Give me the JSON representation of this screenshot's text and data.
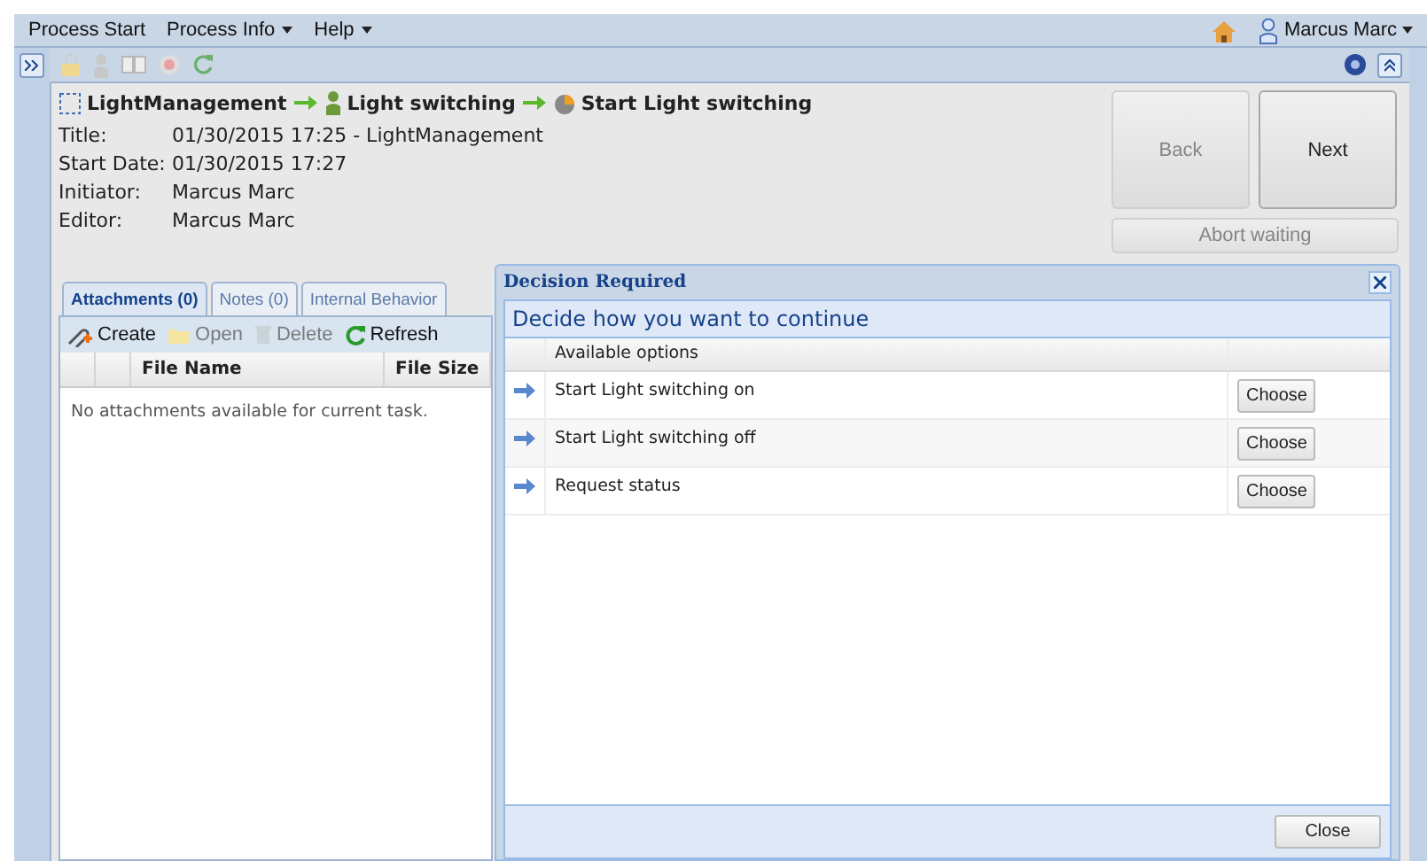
{
  "menu": [
    {
      "label": "Process Start",
      "dropdown": false
    },
    {
      "label": "Process Info",
      "dropdown": true
    },
    {
      "label": "Help",
      "dropdown": true
    }
  ],
  "user": {
    "name": "Marcus Marc",
    "dropdown": true
  },
  "breadcrumb": [
    {
      "label": "LightManagement",
      "kind": "process"
    },
    {
      "label": "Light switching",
      "kind": "lane"
    },
    {
      "label": "Start Light switching",
      "kind": "activity"
    }
  ],
  "details": [
    {
      "label": "Title:",
      "value": "01/30/2015 17:25 - LightManagement"
    },
    {
      "label": "Start Date:",
      "value": "01/30/2015 17:27"
    },
    {
      "label": "Initiator:",
      "value": "Marcus Marc"
    },
    {
      "label": "Editor:",
      "value": "Marcus Marc"
    }
  ],
  "buttons": [
    {
      "label": "Back",
      "disabled": true
    },
    {
      "label": "Next",
      "disabled": false
    }
  ],
  "abort": {
    "label": "Abort waiting",
    "disabled": true
  },
  "tabs": [
    {
      "label": "Attachments (0)",
      "selected": true
    },
    {
      "label": "Notes (0)",
      "selected": false
    },
    {
      "label": "Internal Behavior",
      "selected": false
    }
  ],
  "actions": [
    {
      "label": "Create",
      "kind": "create",
      "disabled": false
    },
    {
      "label": "Open",
      "kind": "open",
      "disabled": true
    },
    {
      "label": "Delete",
      "kind": "delete",
      "disabled": true
    },
    {
      "label": "Refresh",
      "kind": "refresh",
      "disabled": false
    }
  ],
  "columns": [
    "File Name",
    "File Size"
  ],
  "empty_text": "No attachments available for current task.",
  "dialog": {
    "title": "Decision Required",
    "heading": "Decide how you want to continue",
    "column": "Available options",
    "options": [
      {
        "label": "Start Light switching on",
        "button": "Choose"
      },
      {
        "label": "Start Light switching off",
        "button": "Choose"
      },
      {
        "label": "Request status",
        "button": "Choose"
      }
    ],
    "close": "Close"
  }
}
